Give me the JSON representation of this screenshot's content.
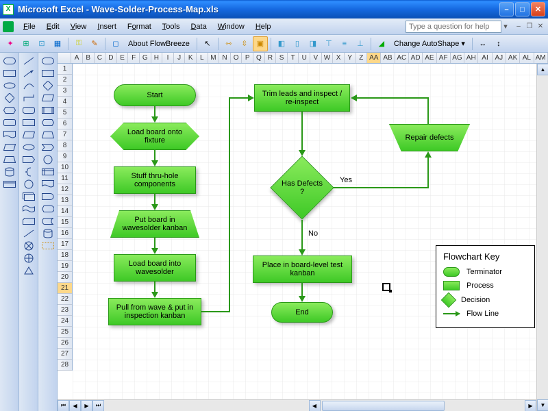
{
  "window": {
    "title": "Microsoft Excel - Wave-Solder-Process-Map.xls"
  },
  "menu": {
    "file": "File",
    "edit": "Edit",
    "view": "View",
    "insert": "Insert",
    "format": "Format",
    "tools": "Tools",
    "data": "Data",
    "window": "Window",
    "help": "Help"
  },
  "helpbox": {
    "placeholder": "Type a question for help"
  },
  "toolbar": {
    "about": "About FlowBreeze",
    "autoshape": "Change AutoShape"
  },
  "columns": [
    "A",
    "B",
    "C",
    "D",
    "E",
    "F",
    "G",
    "H",
    "I",
    "J",
    "K",
    "L",
    "M",
    "N",
    "O",
    "P",
    "Q",
    "R",
    "S",
    "T",
    "U",
    "V",
    "W",
    "X",
    "Y",
    "Z",
    "AA",
    "AB",
    "AC",
    "AD",
    "AE",
    "AF",
    "AG",
    "AH",
    "AI",
    "AJ",
    "AK",
    "AL",
    "AM"
  ],
  "selected_col_index": 26,
  "rows": [
    "1",
    "2",
    "3",
    "4",
    "5",
    "6",
    "7",
    "8",
    "9",
    "10",
    "11",
    "12",
    "13",
    "14",
    "15",
    "16",
    "17",
    "18",
    "19",
    "20",
    "21",
    "22",
    "23",
    "24",
    "25",
    "26",
    "27",
    "28"
  ],
  "selected_row_index": 20,
  "nodes": {
    "start": "Start",
    "load_fixture": "Load board onto fixture",
    "stuff": "Stuff thru-hole components",
    "put_kanban": "Put board in wavesolder kanban",
    "load_wavesolder": "Load board into wavesolder",
    "pull_inspect": "Pull from wave & put in inspection kanban",
    "trim": "Trim leads and inspect / re-inspect",
    "repair": "Repair defects",
    "decision": "Has Defects ?",
    "yes": "Yes",
    "no": "No",
    "place": "Place in board-level test kanban",
    "end": "End"
  },
  "key": {
    "title": "Flowchart Key",
    "terminator": "Terminator",
    "process": "Process",
    "decision": "Decision",
    "flowline": "Flow Line"
  }
}
